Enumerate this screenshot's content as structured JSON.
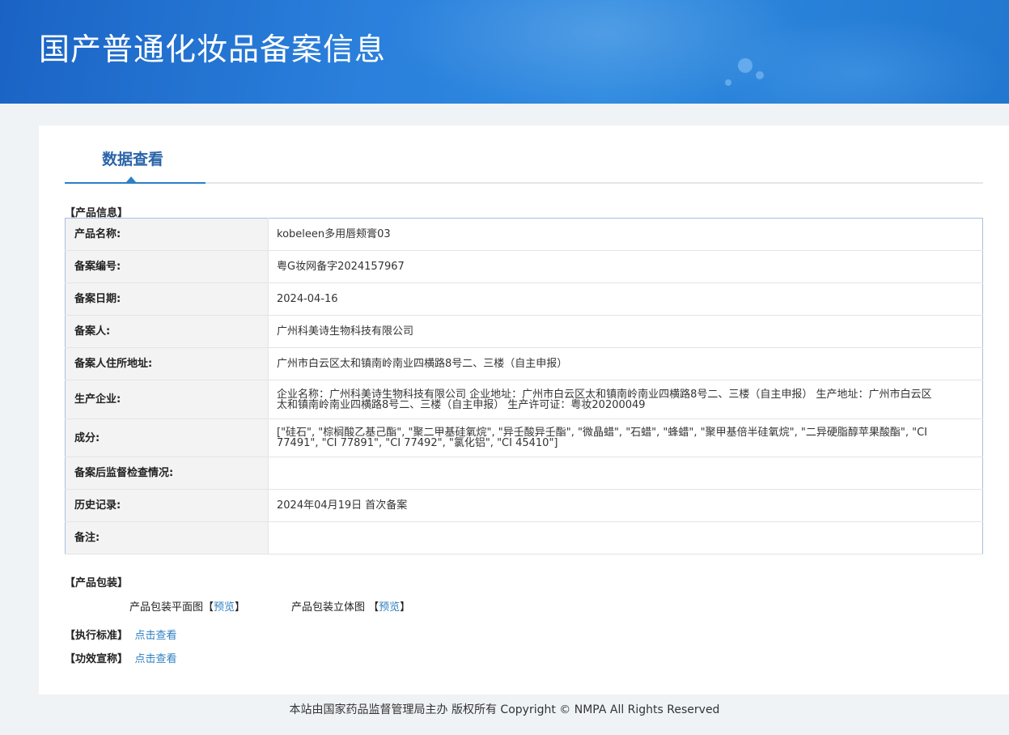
{
  "page_title": "国产普通化妆品备案信息",
  "tab": {
    "label": "数据查看"
  },
  "product_info": {
    "section_title": "【产品信息】",
    "rows": [
      {
        "label": "产品名称:",
        "value": "kobeleen多用唇颊膏03"
      },
      {
        "label": "备案编号:",
        "value": "粤G妆网备字2024157967"
      },
      {
        "label": "备案日期:",
        "value": "2024-04-16"
      },
      {
        "label": "备案人:",
        "value": "广州科美诗生物科技有限公司"
      },
      {
        "label": "备案人住所地址:",
        "value": "广州市白云区太和镇南岭南业四横路8号二、三楼（自主申报）"
      },
      {
        "label": "生产企业:",
        "value": "企业名称：广州科美诗生物科技有限公司 企业地址：广州市白云区太和镇南岭南业四横路8号二、三楼（自主申报） 生产地址：广州市白云区太和镇南岭南业四横路8号二、三楼（自主申报） 生产许可证：粤妆20200049"
      },
      {
        "label": "成分:",
        "value": "[\"硅石\", \"棕榈酸乙基己酯\", \"聚二甲基硅氧烷\", \"异壬酸异壬酯\", \"微晶蜡\", \"石蜡\", \"蜂蜡\", \"聚甲基倍半硅氧烷\", \"二异硬脂醇苹果酸酯\", \"CI 77491\", \"CI 77891\", \"CI 77492\", \"氯化铝\", \"CI 45410\"]"
      },
      {
        "label": "备案后监督检查情况:",
        "value": ""
      },
      {
        "label": "历史记录:",
        "value": "2024年04月19日 首次备案"
      },
      {
        "label": "备注:",
        "value": ""
      }
    ]
  },
  "packaging": {
    "section_title": "【产品包装】",
    "flat_label": "产品包装平面图",
    "flat_link": "预览",
    "stereo_label": "产品包装立体图",
    "stereo_link": "预览"
  },
  "standard": {
    "label": "【执行标准】",
    "link": "点击查看"
  },
  "efficacy": {
    "label": "【功效宣称】",
    "link": "点击查看"
  },
  "footer": {
    "text": "本站由国家药品监督管理局主办 版权所有 Copyright © NMPA All Rights Reserved"
  }
}
